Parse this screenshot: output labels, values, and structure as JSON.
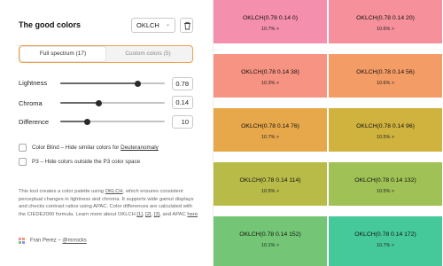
{
  "header": {
    "title": "The good colors",
    "format_value": "OKLCH",
    "format_chevron": "⌄",
    "trash_icon": "trash-icon"
  },
  "tabs": [
    {
      "label": "Full spectrum (17)",
      "selected": true
    },
    {
      "label": "Custom colors (5)",
      "selected": false
    }
  ],
  "params": {
    "lightness": {
      "label": "Lightness",
      "value": "0.78",
      "fraction": 0.745
    },
    "chroma": {
      "label": "Chroma",
      "value": "0.14",
      "fraction": 0.37
    },
    "difference": {
      "label": "Difference",
      "value": "10",
      "fraction": 0.26
    }
  },
  "options": {
    "color_blind": {
      "text": "Color Blind – Hide similar colors for ",
      "link": "Deuteranomaly",
      "checked": false
    },
    "p3": {
      "text": "P3 – Hide colors outside the P3 color space",
      "checked": false
    }
  },
  "description": {
    "part1": "This tool creates a color palette using ",
    "link_oklch": "OKLCH",
    "part2": ", which ensures consistent perceptual changes in lightness and chroma. It supports wide gamut displays and checks contrast ratios using APAC. Color differences are calculated with the CIEDE2000 formula. Learn more about OKLCH ",
    "ref1": "[1]",
    "sep1": ", ",
    "ref2": "[2]",
    "sep2": ", ",
    "ref3": "[3]",
    "part3": ", and APAC ",
    "link_here": "here",
    "part4": "."
  },
  "author": {
    "name": "Fran Perez – ",
    "handle": "@mrrocks"
  },
  "colors": {
    "accent": "#f2a14a",
    "swatches": [
      {
        "name": "OKLCH(0.78 0.14 0)",
        "contrast": "10.7% >",
        "hex": "#f58fae"
      },
      {
        "name": "OKLCH(0.78 0.14 20)",
        "contrast": "10.6% >",
        "hex": "#f6909a"
      },
      {
        "name": "OKLCH(0.78 0.14 38)",
        "contrast": "10.3% >",
        "hex": "#f69382"
      },
      {
        "name": "OKLCH(0.78 0.14 56)",
        "contrast": "10.6% >",
        "hex": "#f49c66"
      },
      {
        "name": "OKLCH(0.78 0.14 76)",
        "contrast": "10.7% >",
        "hex": "#e6a84a"
      },
      {
        "name": "OKLCH(0.78 0.14 96)",
        "contrast": "10.5% >",
        "hex": "#cfb33e"
      },
      {
        "name": "OKLCH(0.78 0.14 114)",
        "contrast": "10.5% >",
        "hex": "#b8bb48"
      },
      {
        "name": "OKLCH(0.78 0.14 132)",
        "contrast": "10.5% >",
        "hex": "#9fc155"
      },
      {
        "name": "OKLCH(0.78 0.14 152)",
        "contrast": "10.1% >",
        "hex": "#74c676"
      },
      {
        "name": "OKLCH(0.78 0.14 172)",
        "contrast": "10.7% >",
        "hex": "#46c99a"
      }
    ]
  }
}
